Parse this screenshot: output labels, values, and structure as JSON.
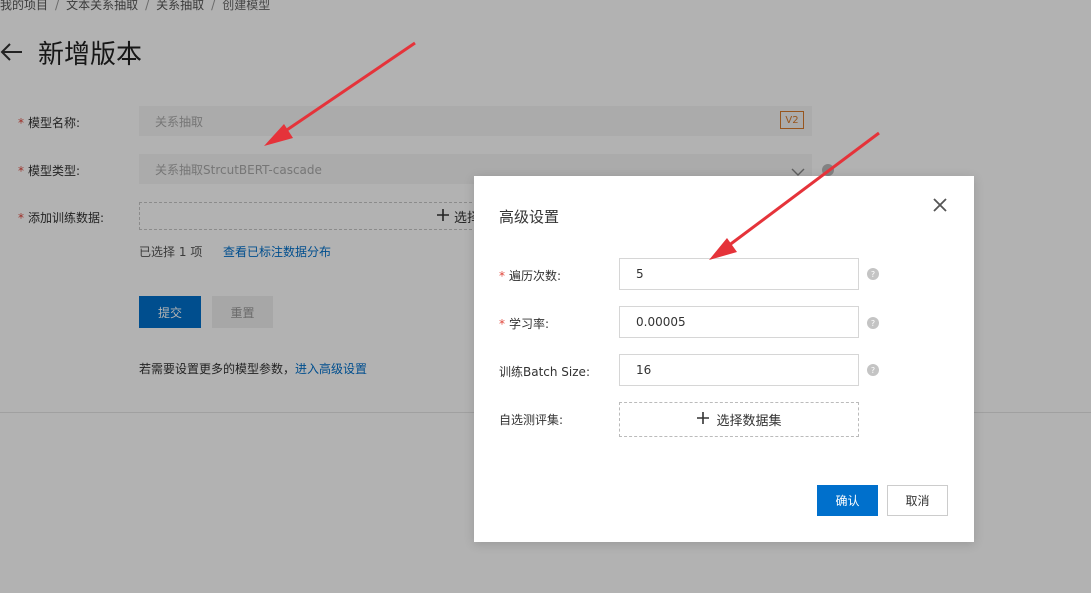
{
  "breadcrumb": {
    "items": [
      "我的项目",
      "文本关系抽取",
      "关系抽取",
      "创建模型"
    ]
  },
  "page": {
    "title": "新增版本"
  },
  "form": {
    "model_name": {
      "label": "模型名称:",
      "value": "关系抽取",
      "version": "V2"
    },
    "model_type": {
      "label": "模型类型:",
      "value": "关系抽取StrcutBERT-cascade"
    },
    "training_data": {
      "label": "添加训练数据:",
      "button_label": "选择"
    },
    "selected_prefix": "已选择",
    "selected_count": "1",
    "selected_suffix": "项",
    "view_link": "查看已标注数据分布",
    "submit_label": "提交",
    "reset_label": "重置",
    "hint_text": "若需要设置更多的模型参数，",
    "hint_link": "进入高级设置"
  },
  "modal": {
    "title": "高级设置",
    "fields": {
      "epochs": {
        "label": "遍历次数:",
        "value": "5"
      },
      "learning_rate": {
        "label": "学习率:",
        "value": "0.00005"
      },
      "batch_size": {
        "label": "训练Batch Size:",
        "value": "16"
      },
      "eval_set": {
        "label": "自选测评集:",
        "button_label": "选择数据集"
      }
    },
    "confirm_label": "确认",
    "cancel_label": "取消"
  },
  "colors": {
    "primary": "#0070cc",
    "required": "#e0463b",
    "badge": "#d97a2b",
    "annotation_arrow": "#e5333a"
  },
  "icons": [
    "back-arrow-icon",
    "chevron-down-icon",
    "help-icon",
    "plus-icon",
    "close-icon"
  ]
}
